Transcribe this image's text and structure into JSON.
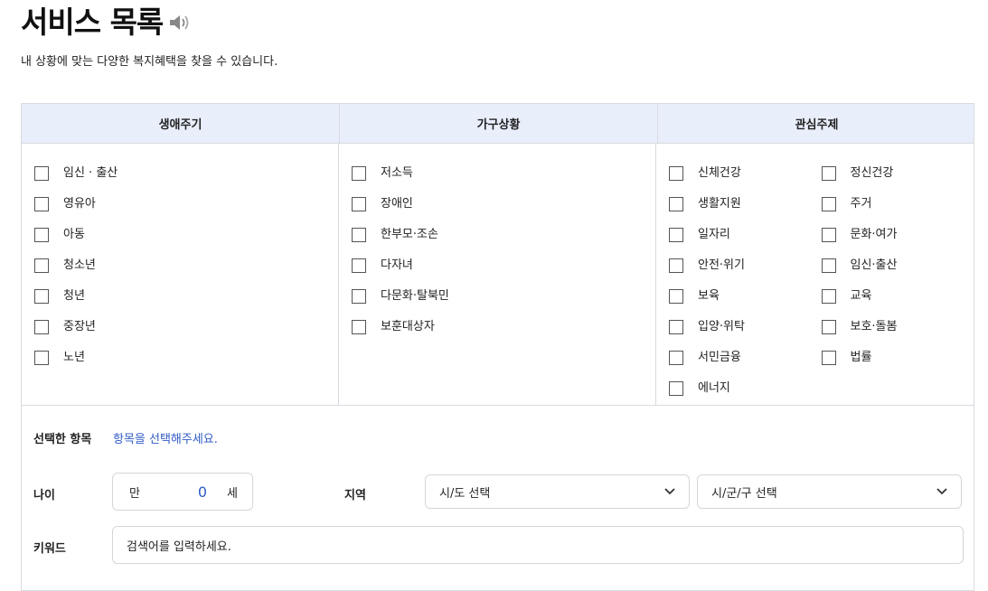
{
  "header": {
    "title": "서비스 목록",
    "subtitle": "내 상황에 맞는 다양한 복지혜택을 찾을 수 있습니다."
  },
  "filters": {
    "life_cycle": {
      "header": "생애주기",
      "items": [
        "임신 · 출산",
        "영유아",
        "아동",
        "청소년",
        "청년",
        "중장년",
        "노년"
      ]
    },
    "household": {
      "header": "가구상황",
      "items": [
        "저소득",
        "장애인",
        "한부모·조손",
        "다자녀",
        "다문화·탈북민",
        "보훈대상자"
      ]
    },
    "interest": {
      "header": "관심주제",
      "col1": [
        "신체건강",
        "생활지원",
        "일자리",
        "안전·위기",
        "보육",
        "입양·위탁",
        "서민금융",
        "에너지"
      ],
      "col2": [
        "정신건강",
        "주거",
        "문화·여가",
        "임신·출산",
        "교육",
        "보호·돌봄",
        "법률"
      ]
    }
  },
  "selected": {
    "label": "선택한 항목",
    "value": "항목을 선택해주세요."
  },
  "age": {
    "label": "나이",
    "prefix": "만",
    "value": "0",
    "suffix": "세"
  },
  "region": {
    "label": "지역",
    "province_placeholder": "시/도 선택",
    "district_placeholder": "시/군/구 선택"
  },
  "keyword": {
    "label": "키워드",
    "placeholder": "검색어를 입력하세요."
  },
  "colors": {
    "header_bg": "#e9eefb",
    "accent_blue": "#2f5bc5",
    "border": "#d8dbe0"
  },
  "icons": {
    "speaker": "speaker-icon",
    "chevron": "chevron-down-icon"
  }
}
